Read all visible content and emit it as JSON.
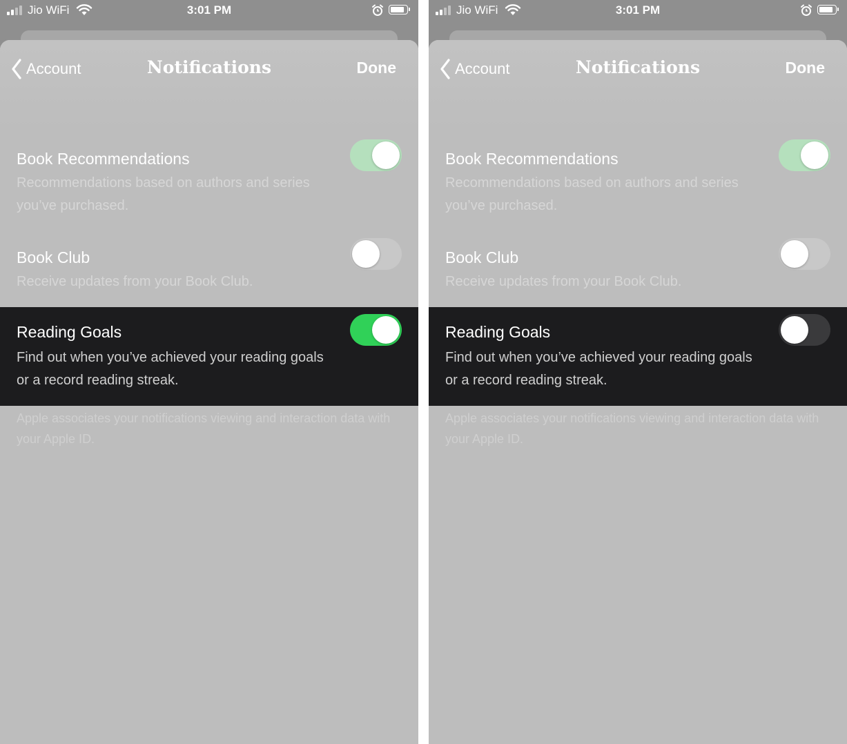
{
  "status_bar": {
    "carrier": "Jio WiFi",
    "time": "3:01 PM"
  },
  "nav": {
    "back_label": "Account",
    "title": "Notifications",
    "done_label": "Done"
  },
  "settings": [
    {
      "title": "Book Recommendations",
      "description": "Recommendations based on authors and series you’ve purchased."
    },
    {
      "title": "Book Club",
      "description": "Receive updates from your Book Club."
    },
    {
      "title": "Reading Goals",
      "description": "Find out when you’ve achieved your reading goals or a record reading streak."
    }
  ],
  "footer_text": "Apple associates your notifications viewing and interaction data with your Apple ID.",
  "screens": [
    {
      "toggles": {
        "book_recommendations": "on",
        "book_club": "off",
        "reading_goals": "on"
      }
    },
    {
      "toggles": {
        "book_recommendations": "on",
        "book_club": "off",
        "reading_goals": "off"
      }
    }
  ],
  "colors": {
    "toggle_on": "#30d158",
    "toggle_on_dimmed": "#b5e0bd",
    "toggle_off_dimmed": "#c8c8c8",
    "toggle_off_dark": "#3a3a3c",
    "highlight_row": "#1c1c1e",
    "overlay_background": "#bdbdbd"
  },
  "icons": [
    "cellular-signal-icon",
    "wifi-icon",
    "alarm-icon",
    "battery-icon",
    "chevron-left-icon"
  ]
}
